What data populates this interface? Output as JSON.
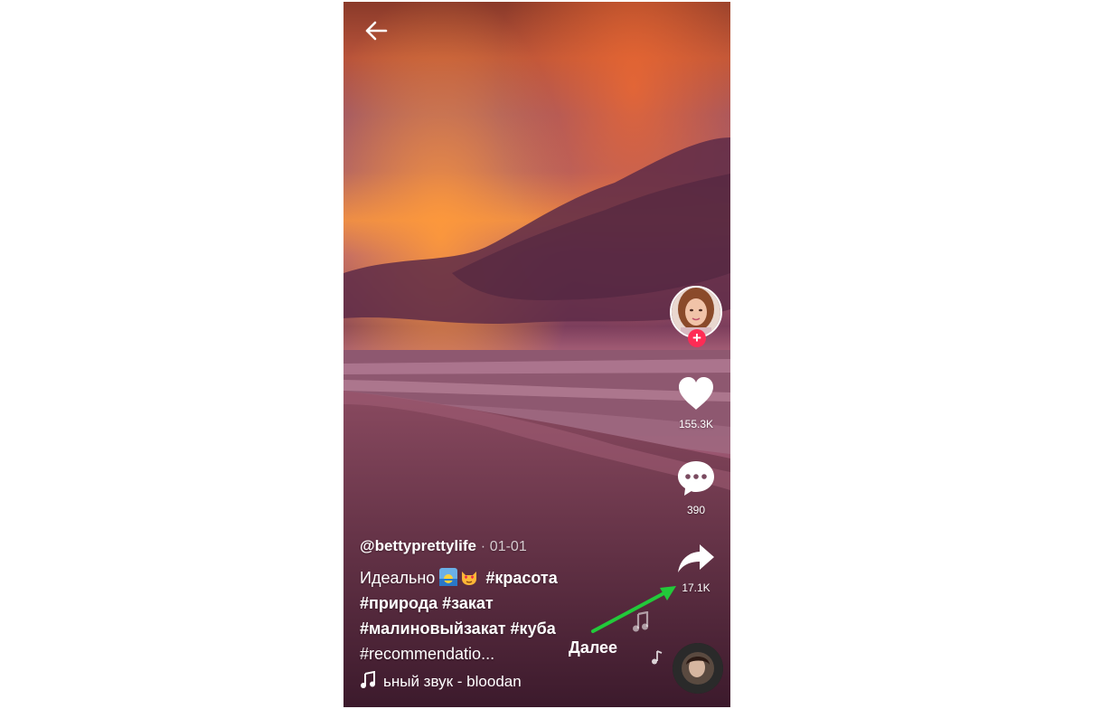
{
  "video": {
    "author": "@bettyprettylife",
    "date_separator": "·",
    "date": "01-01",
    "description_text": "Идеально",
    "hashtags": [
      "#красота",
      "#природа",
      "#закат",
      "#малиновыйзакат",
      "#куба",
      "#recommendatio..."
    ],
    "more_label": "Далее",
    "sound": "ьный звук - bloodan"
  },
  "actions": {
    "likes": "155.3K",
    "comments": "390",
    "shares": "17.1K"
  },
  "icons": {
    "back": "arrow-left-icon",
    "like": "heart-icon",
    "comment": "comment-bubble-icon",
    "share": "share-arrow-icon",
    "music": "music-note-icon",
    "follow": "plus-icon"
  },
  "colors": {
    "follow_accent": "#fe2c55",
    "annotation_arrow": "#22c93a"
  }
}
